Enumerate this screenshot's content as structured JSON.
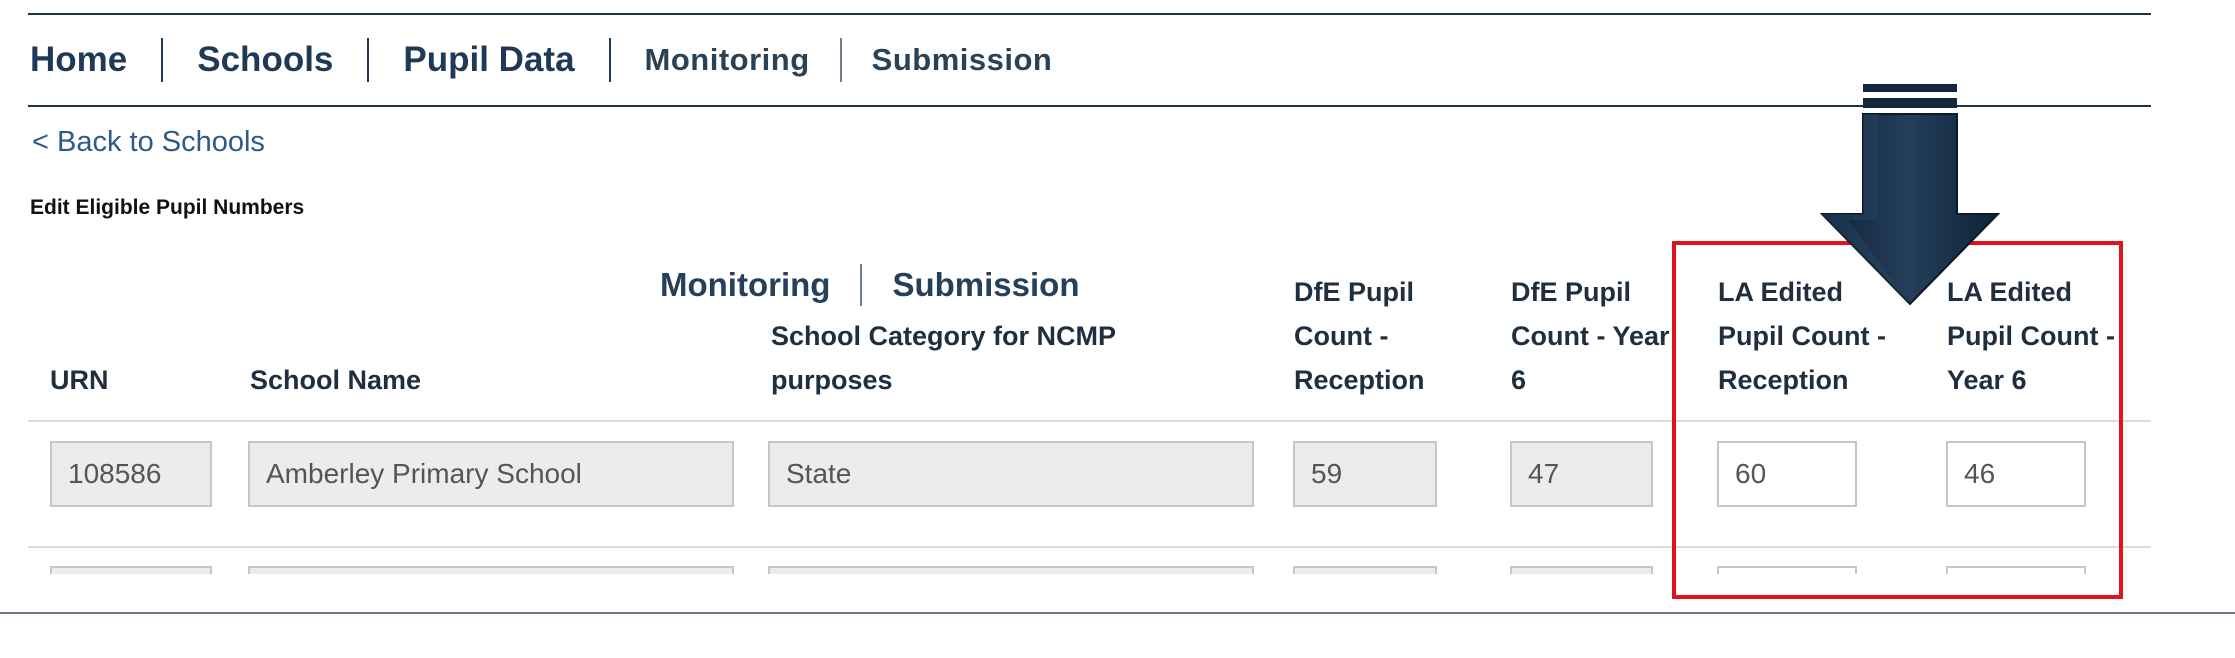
{
  "nav": {
    "items": [
      {
        "label": "Home"
      },
      {
        "label": "Schools"
      },
      {
        "label": "Pupil Data"
      },
      {
        "label": "Monitoring"
      },
      {
        "label": "Submission"
      }
    ]
  },
  "back_link": "< Back to Schools",
  "section_title": "Edit Eligible Pupil Numbers",
  "header_overlay": {
    "items": [
      {
        "label": "Monitoring"
      },
      {
        "label": "Submission"
      }
    ]
  },
  "table": {
    "headers": {
      "urn": "URN",
      "school_name": "School Name",
      "category": "School Category for NCMP purposes",
      "dfe_reception": "DfE Pupil Count - Reception",
      "dfe_year6": "DfE Pupil Count - Year 6",
      "la_reception": "LA Edited Pupil Count - Reception",
      "la_year6": "LA Edited Pupil Count - Year 6"
    },
    "rows": [
      {
        "urn": "108586",
        "school_name": "Amberley Primary School",
        "category": "State",
        "dfe_reception": "59",
        "dfe_year6": "47",
        "la_reception": "60",
        "la_year6": "46"
      }
    ]
  },
  "colors": {
    "nav_text": "#1f3a57",
    "link": "#2e5a87",
    "highlight_border": "#e0141c",
    "arrow": "#14283d"
  },
  "icons": {
    "annotation": "down-arrow-icon"
  }
}
